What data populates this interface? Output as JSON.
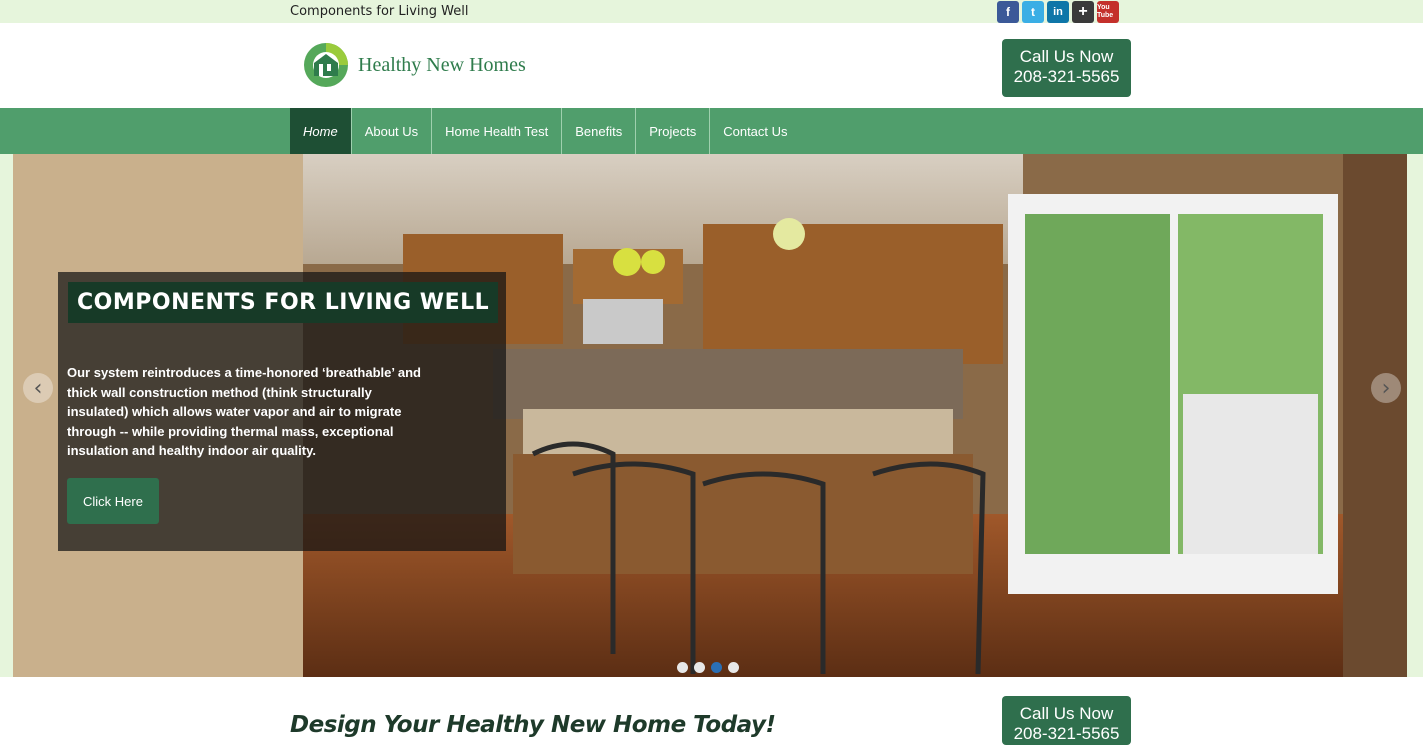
{
  "topbar": {
    "tagline": "Components for Living Well",
    "social": [
      {
        "icon": "facebook-icon",
        "glyph": "f"
      },
      {
        "icon": "twitter-icon",
        "glyph": "t"
      },
      {
        "icon": "linkedin-icon",
        "glyph": "in"
      },
      {
        "icon": "google-plus-icon",
        "glyph": "+"
      },
      {
        "icon": "youtube-icon",
        "glyph": "You Tube"
      }
    ]
  },
  "header": {
    "logo_text": "Healthy New Homes",
    "call_line1": "Call Us Now",
    "call_line2": "208-321-5565"
  },
  "nav": {
    "items": [
      "Home",
      "About Us",
      "Home Health Test",
      "Benefits",
      "Projects",
      "Contact Us"
    ],
    "active": "Home"
  },
  "slider": {
    "title": "COMPONENTS FOR LIVING WELL",
    "text": "Our system reintroduces a time-honored ‘breathable’ and thick wall construction method (think structurally insulated) which allows water vapor and air to migrate through -- while providing thermal mass, exceptional insulation and healthy indoor air quality.",
    "button": "Click Here",
    "prev_glyph": "‹",
    "next_glyph": "›",
    "slide_count": 4,
    "active_slide": 3
  },
  "below": {
    "heading": "Design Your Healthy New Home Today!",
    "call_line1": "Call Us Now",
    "call_line2": "208-321-5565"
  },
  "colors": {
    "nav_green": "#509e6c",
    "dark_green": "#2f6f4d",
    "page_bg": "#e6f5dc"
  }
}
